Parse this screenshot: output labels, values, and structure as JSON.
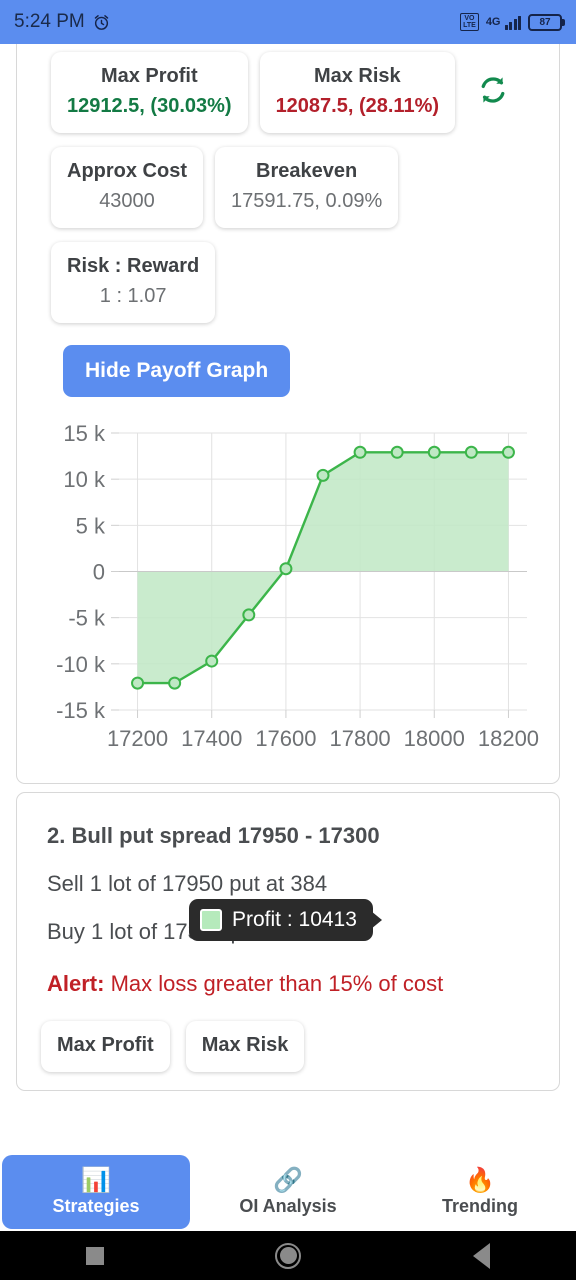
{
  "status_bar": {
    "time": "5:24 PM",
    "alarm_icon": "alarm-clock-icon",
    "volte_top": "VO",
    "volte_bottom": "LTE",
    "network": "4G",
    "battery_level": "87"
  },
  "strategy_1": {
    "stats": [
      {
        "label": "Max Profit",
        "value": "12912.5, (30.03%)",
        "tone": "green"
      },
      {
        "label": "Max Risk",
        "value": "12087.5, (28.11%)",
        "tone": "red"
      },
      {
        "label": "Approx Cost",
        "value": "43000",
        "tone": "neutral"
      },
      {
        "label": "Breakeven",
        "value": "17591.75, 0.09%",
        "tone": "neutral"
      },
      {
        "label": "Risk : Reward",
        "value": "1 : 1.07",
        "tone": "neutral"
      }
    ],
    "refresh_icon": "refresh-icon",
    "toggle_label": "Hide Payoff Graph",
    "tooltip": {
      "label": "Profit : 10413",
      "swatch_color": "#b6eabc"
    }
  },
  "chart_data": {
    "type": "area",
    "title": "",
    "xlabel": "",
    "ylabel": "",
    "x": [
      17200,
      17300,
      17400,
      17500,
      17600,
      17700,
      17800,
      17900,
      18000,
      18100,
      18200
    ],
    "values": [
      -12087,
      -12087,
      -9700,
      -4700,
      300,
      10413,
      12912,
      12912,
      12912,
      12912,
      12912
    ],
    "series_name": "Profit",
    "xticks": [
      "17200",
      "17400",
      "17600",
      "17800",
      "18000",
      "18200"
    ],
    "yticks": [
      "15 k",
      "10 k",
      "5 k",
      "0",
      "-5 k",
      "-10 k",
      "-15 k"
    ],
    "ylim": [
      -15000,
      15000
    ],
    "xlim": [
      17150,
      18250
    ],
    "grid": true,
    "legend": "none",
    "line_color": "#3cb54a",
    "fill_color": "#bfe8c4",
    "marker_color": "#3cb54a",
    "zero_line": 0
  },
  "strategy_2": {
    "title": "2. Bull put spread 17950 - 17300",
    "leg_sell": "Sell 1 lot of 17950 put at 384",
    "leg_buy": "Buy 1 lot of 17300 put at 26.7",
    "alert_prefix": "Alert:",
    "alert_text": " Max loss greater than 15% of cost",
    "stats": [
      {
        "label": "Max Profit"
      },
      {
        "label": "Max Risk"
      }
    ]
  },
  "bottom_nav": {
    "items": [
      {
        "label": "Strategies",
        "icon": "📊",
        "icon_name": "bar-chart-icon",
        "active": true
      },
      {
        "label": "OI Analysis",
        "icon": "🔗",
        "icon_name": "link-icon",
        "active": false
      },
      {
        "label": "Trending",
        "icon": "🔥",
        "icon_name": "fire-icon",
        "active": false
      }
    ]
  },
  "android_nav": {
    "recents": "recents-button",
    "home": "home-button",
    "back": "back-button"
  },
  "colors": {
    "accent": "#5B8DEF",
    "profit_green": "#137a44",
    "risk_red": "#b3202b",
    "alert_red": "#c02026"
  }
}
